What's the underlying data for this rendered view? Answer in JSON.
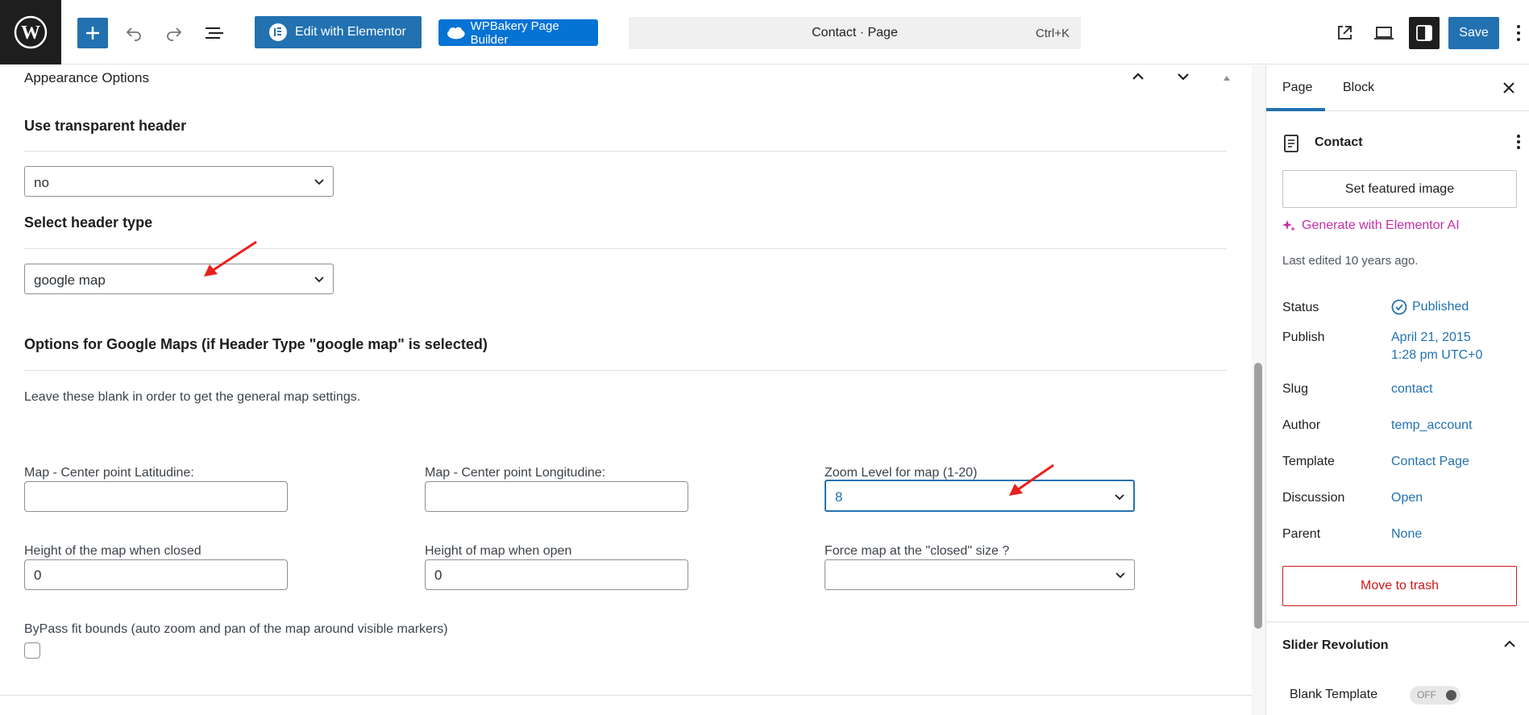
{
  "toolbar": {
    "elementor_label": "Edit with Elementor",
    "wpbakery_label": "WPBakery Page Builder",
    "command_title": "Contact · Page",
    "command_shortcut": "Ctrl+K",
    "save_label": "Save"
  },
  "main": {
    "section_title": "Appearance Options",
    "transparent_header_label": "Use transparent header",
    "transparent_header_value": "no",
    "header_type_label": "Select header type",
    "header_type_value": "google map",
    "maps_options_title": "Options for Google Maps (if Header Type \"google map\" is selected)",
    "maps_note": "Leave these blank in order to get the general map settings.",
    "lat_label": "Map - Center point Latitudine:",
    "lat_value": "",
    "lng_label": "Map - Center point Longitudine:",
    "lng_value": "",
    "zoom_label": "Zoom Level for map (1-20)",
    "zoom_value": "8",
    "height_closed_label": "Height of the map when closed",
    "height_closed_value": "0",
    "height_open_label": "Height of map when open",
    "height_open_value": "0",
    "force_closed_label": "Force map at the \"closed\" size ?",
    "force_closed_value": "",
    "bypass_label": "ByPass fit bounds (auto zoom and pan of the map around visible markers)"
  },
  "sidebar": {
    "tab_page": "Page",
    "tab_block": "Block",
    "doc_title": "Contact",
    "featured_image": "Set featured image",
    "ai_link": "Generate with Elementor AI",
    "last_edited": "Last edited 10 years ago.",
    "meta": [
      {
        "label": "Status",
        "value": "Published"
      },
      {
        "label": "Publish",
        "value": "April 21, 2015",
        "value2": "1:28 pm UTC+0"
      },
      {
        "label": "Slug",
        "value": "contact"
      },
      {
        "label": "Author",
        "value": "temp_account"
      },
      {
        "label": "Template",
        "value": "Contact Page"
      },
      {
        "label": "Discussion",
        "value": "Open"
      },
      {
        "label": "Parent",
        "value": "None"
      }
    ],
    "trash": "Move to trash",
    "slider_panel_title": "Slider Revolution",
    "blank_template": "Blank Template",
    "toggle_state": "OFF"
  },
  "colors": {
    "accent": "#2271b1",
    "danger": "#cc1818",
    "ai": "#c42ea6",
    "annotation": "#e8211d"
  }
}
